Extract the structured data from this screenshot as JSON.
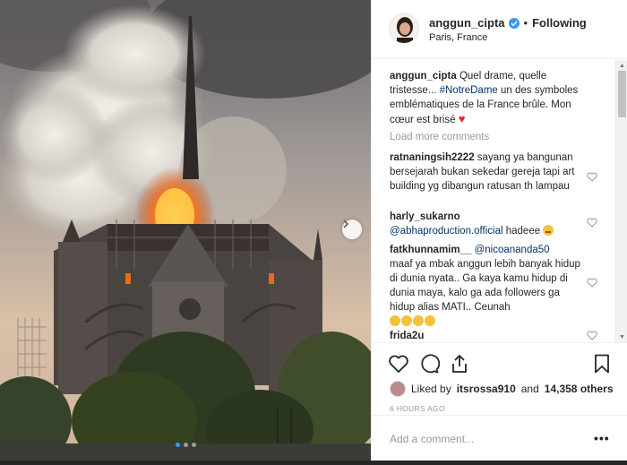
{
  "header": {
    "username": "anggun_cipta",
    "separator": "•",
    "follow_label": "Following",
    "location": "Paris, France"
  },
  "caption": {
    "username": "anggun_cipta",
    "text_a": "Quel drame, quelle tristesse...",
    "hashtag": "#NotreDame",
    "text_b": "un des symboles emblématiques de la France brûle. Mon cœur est brisé"
  },
  "load_more_label": "Load more comments",
  "comments": [
    {
      "username": "ratnaningsih2222",
      "text": "sayang ya bangunan bersejarah bukan sekedar gereja tapi art building yg dibangun ratusan th lampau"
    },
    {
      "username": "harly_sukarno",
      "mention": "@abhaproduction.official",
      "text": "hadeee"
    },
    {
      "username": "fatkhunnamim__",
      "mention": "@nicoanandа50",
      "text": "maaf ya mbak anggun lebih banyak hidup di dunia nyata.. Ga kaya kamu hidup di dunia maya, kalo ga ada followers ga hidup alias MATI.. Ceunah"
    },
    {
      "username": "frida2u",
      "text": ""
    }
  ],
  "likes": {
    "prefix": "Liked by",
    "first_user": "itsrossa910",
    "middle": "and",
    "others": "14,358 others"
  },
  "timestamp": "6 HOURS AGO",
  "add_comment_placeholder": "Add a comment...",
  "more_label": "•••",
  "icons": {
    "next": "chevron-right-icon",
    "verified": "verified-badge-icon",
    "like": "heart-icon",
    "comment": "comment-icon",
    "share": "share-icon",
    "save": "bookmark-icon"
  },
  "colors": {
    "link": "#003569",
    "verified": "#3897f0",
    "muted": "#999999"
  }
}
